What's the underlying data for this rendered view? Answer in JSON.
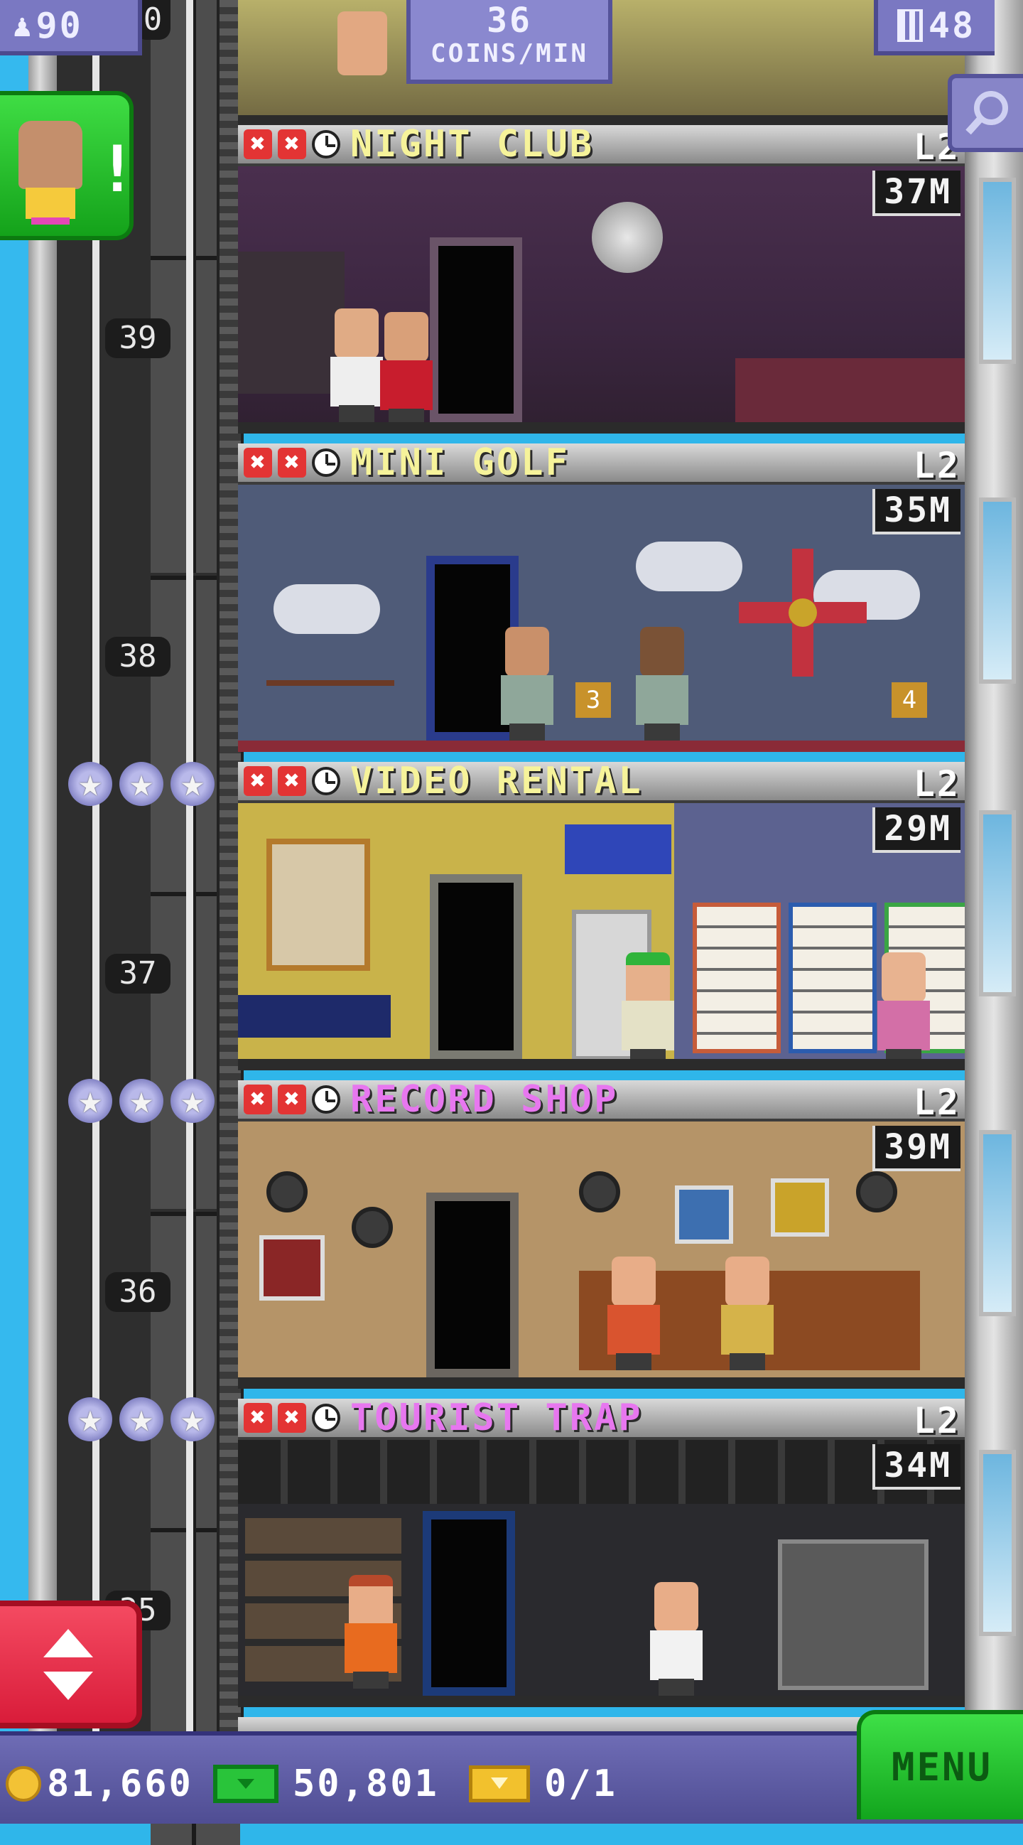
{
  "hud": {
    "population": "90",
    "coins_per_min_value": "36",
    "coins_per_min_unit": "COINS/MIN",
    "floor_count": "48",
    "top_floor_fragment": "0"
  },
  "floors": [
    {
      "name": "NIGHT CLUB",
      "level": "L2",
      "time": "37M",
      "floor_number": "39",
      "name_color": "#f6f39a"
    },
    {
      "name": "MINI GOLF",
      "level": "L2",
      "time": "35M",
      "floor_number": "38",
      "name_color": "#f6f39a"
    },
    {
      "name": "VIDEO RENTAL",
      "level": "L2",
      "time": "29M",
      "floor_number": "37",
      "name_color": "#f6f39a"
    },
    {
      "name": "RECORD SHOP",
      "level": "L2",
      "time": "39M",
      "floor_number": "36",
      "name_color": "#e777ef"
    },
    {
      "name": "TOURIST TRAP",
      "level": "L2",
      "time": "34M",
      "floor_number": "35",
      "name_color": "#e777ef"
    }
  ],
  "mini_golf_flags": [
    "3",
    "4"
  ],
  "bottom_bar": {
    "coins": "81,660",
    "bux": "50,801",
    "tickets": "0/1",
    "menu_label": "MENU"
  },
  "colors": {
    "hud_purple": "#7a78c2",
    "menu_green": "#2fd13a",
    "elevator_red": "#e8304b",
    "sky": "#35b9ee"
  }
}
